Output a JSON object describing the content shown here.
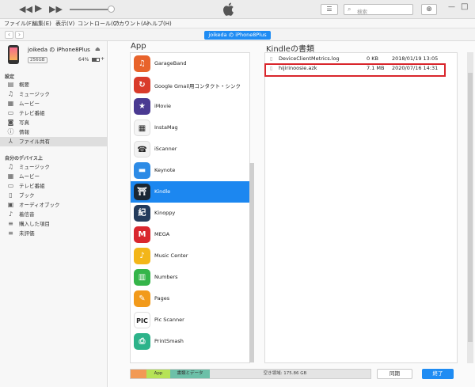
{
  "menu": [
    "ファイル(F)",
    "編集(E)",
    "表示(V)",
    "コントロール(C)",
    "アカウント(A)",
    "ヘルプ(H)"
  ],
  "search_placeholder": "検索",
  "device_tab": "joikeda の iPhone8Plus",
  "device": {
    "name": "joikeda の iPhone8Plus",
    "capacity": "256GB",
    "battery": "64%"
  },
  "sidebar": {
    "settings_heading": "設定",
    "settings_items": [
      "概要",
      "ミュージック",
      "ムービー",
      "テレビ番組",
      "写真",
      "情報",
      "ファイル共有"
    ],
    "selected": "ファイル共有",
    "mydevice_heading": "自分のデバイス上",
    "device_items": [
      "ミュージック",
      "ムービー",
      "テレビ番組",
      "ブック",
      "オーディオブック",
      "着信音",
      "購入した項目",
      "未評価"
    ]
  },
  "app_heading": "App",
  "apps": [
    {
      "name": "GarageBand",
      "color": "#e8632b",
      "glyph": "♫"
    },
    {
      "name": "Google Gmail用コンタクト・シンク",
      "color": "#d93b2b",
      "glyph": "↻"
    },
    {
      "name": "iMovie",
      "color": "#4a3a92",
      "glyph": "★"
    },
    {
      "name": "InstaMag",
      "color": "#f5f5f5",
      "glyph": "▦"
    },
    {
      "name": "iScanner",
      "color": "#f2f2f2",
      "glyph": "☎"
    },
    {
      "name": "Keynote",
      "color": "#2d8be6",
      "glyph": "▬"
    },
    {
      "name": "Kindle",
      "color": "#1a2733",
      "glyph": "⛩"
    },
    {
      "name": "Kinoppy",
      "color": "#233b5c",
      "glyph": "紀"
    },
    {
      "name": "MEGA",
      "color": "#d9272e",
      "glyph": "M"
    },
    {
      "name": "Music Center",
      "color": "#f3b619",
      "glyph": "♪"
    },
    {
      "name": "Numbers",
      "color": "#35b54a",
      "glyph": "▥"
    },
    {
      "name": "Pages",
      "color": "#f29a1a",
      "glyph": "✎"
    },
    {
      "name": "Pic Scanner",
      "color": "#ffffff",
      "glyph": "PIC"
    },
    {
      "name": "PrintSmash",
      "color": "#2db38a",
      "glyph": "⎙"
    }
  ],
  "selected_app": "Kindle",
  "doc_heading": "Kindleの書類",
  "documents": [
    {
      "name": "DeviceClientMetrics.log",
      "size": "0 KB",
      "date": "2018/01/19 13:05"
    },
    {
      "name": "hijirinoosie.azk",
      "size": "7.1 MB",
      "date": "2020/07/16 14:31"
    }
  ],
  "storage": {
    "segments": [
      {
        "label": "",
        "color": "#f29a55"
      },
      {
        "label": "App",
        "color": "#b6e356"
      },
      {
        "label": "書類とデータ",
        "color": "#6cc0a8"
      }
    ],
    "free_label": "空き領域: 175.86 GB"
  },
  "buttons": {
    "sync": "同期",
    "done": "終了"
  }
}
